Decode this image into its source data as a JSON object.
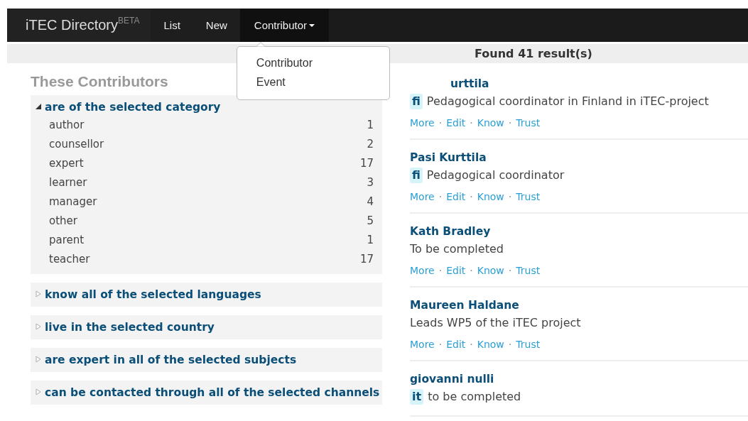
{
  "navbar": {
    "brand": "iTEC Directory",
    "brand_badge": "BETA",
    "items": [
      {
        "label": "List",
        "dropdown": false,
        "expanded": false
      },
      {
        "label": "New",
        "dropdown": false,
        "expanded": false
      },
      {
        "label": "Contributor",
        "dropdown": true,
        "expanded": true
      }
    ],
    "menu": [
      "Contributor",
      "Event"
    ]
  },
  "sidebar": {
    "title": "These Contributors",
    "facets": [
      {
        "label": "are of the selected category",
        "expanded": true,
        "options": [
          {
            "name": "author",
            "count": "1"
          },
          {
            "name": "counsellor",
            "count": "2"
          },
          {
            "name": "expert",
            "count": "17"
          },
          {
            "name": "learner",
            "count": "3"
          },
          {
            "name": "manager",
            "count": "4"
          },
          {
            "name": "other",
            "count": "5"
          },
          {
            "name": "parent",
            "count": "1"
          },
          {
            "name": "teacher",
            "count": "17"
          }
        ]
      },
      {
        "label": "know all of the selected languages",
        "expanded": false
      },
      {
        "label": "live in the selected country",
        "expanded": false
      },
      {
        "label": "are expert in all of the selected subjects",
        "expanded": false
      },
      {
        "label": "can be contacted through all of the selected channels",
        "expanded": false
      }
    ]
  },
  "results": {
    "summary": "Found 41 result(s)",
    "items": [
      {
        "name": "urttila",
        "language": "fi",
        "description": "Pedagogical coordinator in Finland in iTEC-project",
        "actions": [
          {
            "kind": "link",
            "text": "More"
          },
          {
            "kind": "separator",
            "text": "·"
          },
          {
            "kind": "link",
            "text": "Edit"
          },
          {
            "kind": "separator",
            "text": "·"
          },
          {
            "kind": "link",
            "text": "Know"
          },
          {
            "kind": "separator",
            "text": "·"
          },
          {
            "kind": "link",
            "text": "Trust"
          }
        ]
      },
      {
        "name": "Pasi Kurttila",
        "language": "fi",
        "description": "Pedagogical coordinator",
        "actions": [
          {
            "kind": "link",
            "text": "More"
          },
          {
            "kind": "separator",
            "text": "·"
          },
          {
            "kind": "link",
            "text": "Edit"
          },
          {
            "kind": "separator",
            "text": "·"
          },
          {
            "kind": "link",
            "text": "Know"
          },
          {
            "kind": "separator",
            "text": "·"
          },
          {
            "kind": "link",
            "text": "Trust"
          }
        ]
      },
      {
        "name": "Kath Bradley",
        "description": "To be completed",
        "actions": [
          {
            "kind": "link",
            "text": "More"
          },
          {
            "kind": "separator",
            "text": "·"
          },
          {
            "kind": "link",
            "text": "Edit"
          },
          {
            "kind": "separator",
            "text": "·"
          },
          {
            "kind": "link",
            "text": "Know"
          },
          {
            "kind": "separator",
            "text": "·"
          },
          {
            "kind": "link",
            "text": "Trust"
          }
        ]
      },
      {
        "name": "Maureen Haldane",
        "description": "Leads WP5 of the iTEC project",
        "actions": [
          {
            "kind": "link",
            "text": "More"
          },
          {
            "kind": "separator",
            "text": "·"
          },
          {
            "kind": "link",
            "text": "Edit"
          },
          {
            "kind": "separator",
            "text": "·"
          },
          {
            "kind": "link",
            "text": "Know"
          },
          {
            "kind": "separator",
            "text": "·"
          },
          {
            "kind": "link",
            "text": "Trust"
          }
        ]
      },
      {
        "name": "giovanni nulli",
        "language": "it",
        "description": "to be completed"
      }
    ]
  }
}
